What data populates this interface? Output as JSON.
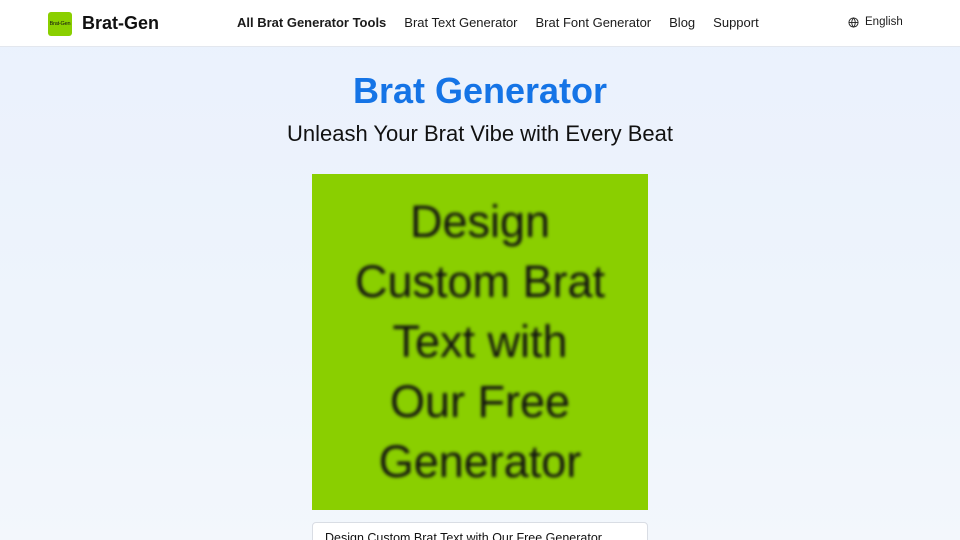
{
  "header": {
    "logo_text": "Brat-Gen",
    "brand_name": "Brat-Gen",
    "nav": [
      {
        "label": "All Brat Generator Tools",
        "active": true
      },
      {
        "label": "Brat Text Generator",
        "active": false
      },
      {
        "label": "Brat Font Generator",
        "active": false
      },
      {
        "label": "Blog",
        "active": false
      },
      {
        "label": "Support",
        "active": false
      }
    ],
    "language": {
      "icon": "globe-icon",
      "label": "English"
    }
  },
  "hero": {
    "title": "Brat Generator",
    "subtitle": "Unleash Your Brat Vibe with Every Beat"
  },
  "preview": {
    "text": "Design\nCustom Brat\nText with\nOur Free\nGenerator",
    "background_color": "#8acf00"
  },
  "editor": {
    "value": "Design Custom Brat Text with Our Free Generator"
  },
  "colors": {
    "accent": "#1574e6",
    "brat_green": "#8acf00"
  }
}
